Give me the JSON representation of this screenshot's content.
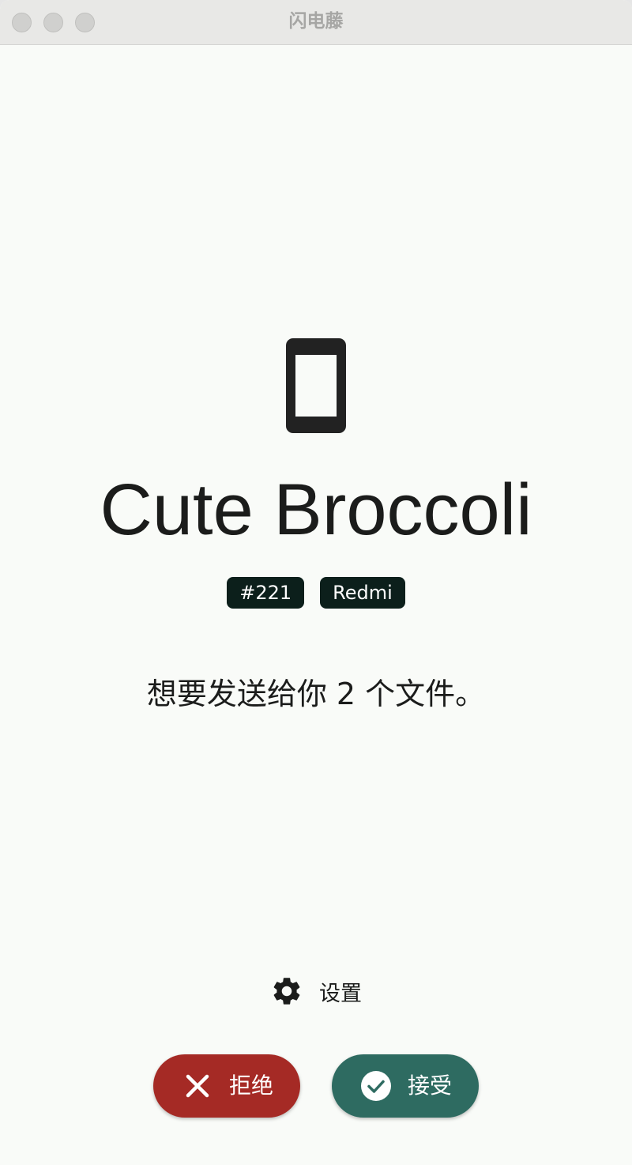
{
  "window": {
    "title": "闪电藤"
  },
  "sender": {
    "device_icon": "smartphone-icon",
    "name": "Cute Broccoli",
    "badges": [
      "#221",
      "Redmi"
    ],
    "message": "想要发送给你 2 个文件。"
  },
  "settings": {
    "icon": "gear-icon",
    "label": "设置"
  },
  "actions": {
    "decline_label": "拒绝",
    "decline_icon": "close-icon",
    "decline_color": "#a52a25",
    "accept_label": "接受",
    "accept_icon": "check-circle-icon",
    "accept_color": "#2e6b61"
  }
}
